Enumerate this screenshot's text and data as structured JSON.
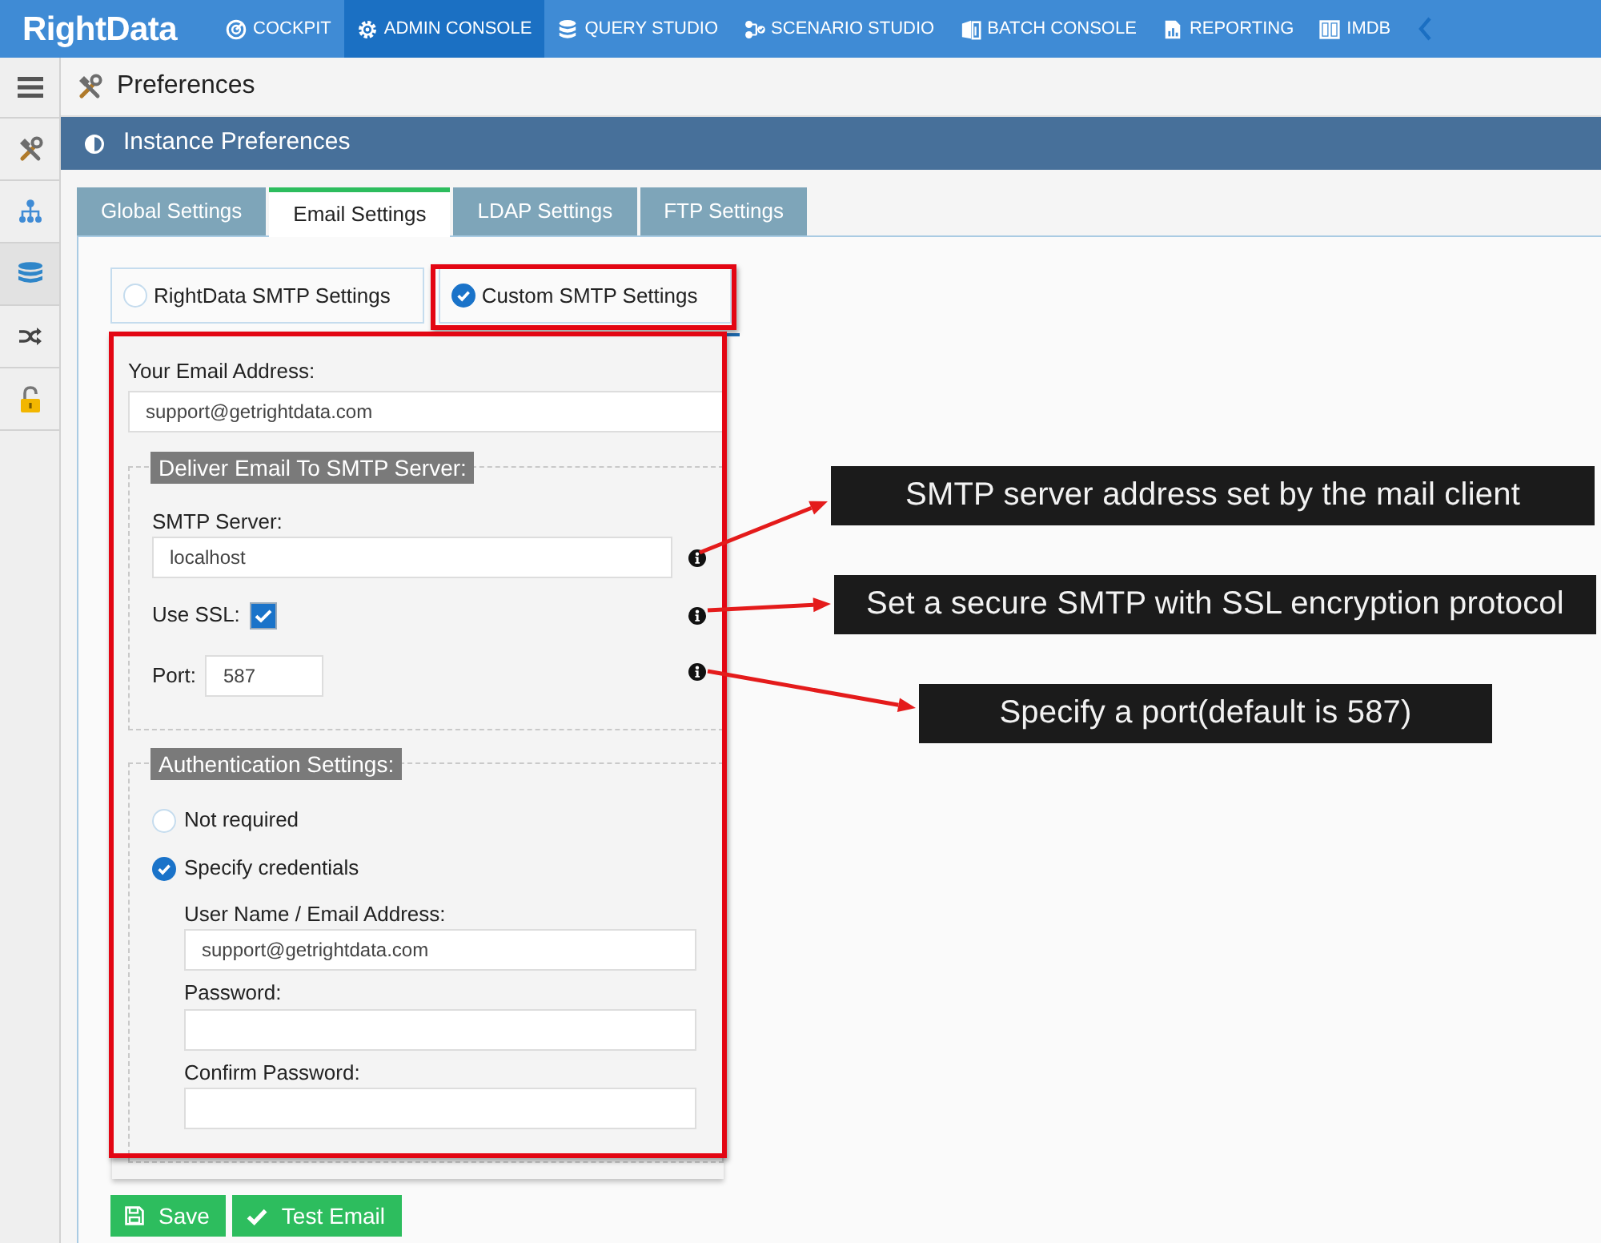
{
  "navbar": {
    "logo": "RightData",
    "items": [
      {
        "label": "COCKPIT",
        "selected": false
      },
      {
        "label": "ADMIN CONSOLE",
        "selected": true
      },
      {
        "label": "QUERY STUDIO",
        "selected": false
      },
      {
        "label": "SCENARIO STUDIO",
        "selected": false
      },
      {
        "label": "BATCH CONSOLE",
        "selected": false
      },
      {
        "label": "REPORTING",
        "selected": false
      },
      {
        "label": "IMDB",
        "selected": false
      }
    ]
  },
  "sidebar": {
    "items": [
      {
        "selected": false
      },
      {
        "selected": false
      },
      {
        "selected": true
      },
      {
        "selected": false
      },
      {
        "selected": false
      }
    ]
  },
  "page_header": {
    "title": "Preferences"
  },
  "panel": {
    "title": "Instance Preferences"
  },
  "tabs": [
    {
      "label": "Global Settings",
      "selected": false
    },
    {
      "label": "Email Settings",
      "selected": true
    },
    {
      "label": "LDAP Settings",
      "selected": false
    },
    {
      "label": "FTP Settings",
      "selected": false
    }
  ],
  "smtp_options": [
    {
      "label": "RightData SMTP Settings",
      "selected": false
    },
    {
      "label": "Custom SMTP Settings",
      "selected": true
    }
  ],
  "email_field": {
    "label": "Your Email Address:",
    "value": "support@getrightdata.com"
  },
  "smtp_section": {
    "legend": "Deliver Email To SMTP Server:",
    "server": {
      "label": "SMTP Server:",
      "value": "localhost"
    },
    "ssl": {
      "label": "Use SSL:",
      "checked": true
    },
    "port": {
      "label": "Port:",
      "value": "587"
    }
  },
  "auth_section": {
    "legend": "Authentication Settings:",
    "options": [
      {
        "label": "Not required",
        "selected": false
      },
      {
        "label": "Specify credentials",
        "selected": true
      }
    ],
    "fields": [
      {
        "label": "User Name / Email Address:",
        "value": "support@getrightdata.com"
      },
      {
        "label": "Password:"
      },
      {
        "label": "Confirm Password:"
      }
    ]
  },
  "buttons": [
    {
      "label": "Save",
      "kind": "save"
    },
    {
      "label": "Test Email",
      "kind": "test"
    }
  ],
  "tooltips": [
    {
      "text": "SMTP server address set by the mail client"
    },
    {
      "text": "Set a secure SMTP with SSL encryption protocol"
    },
    {
      "text": "Specify a port(default is 587)"
    }
  ]
}
